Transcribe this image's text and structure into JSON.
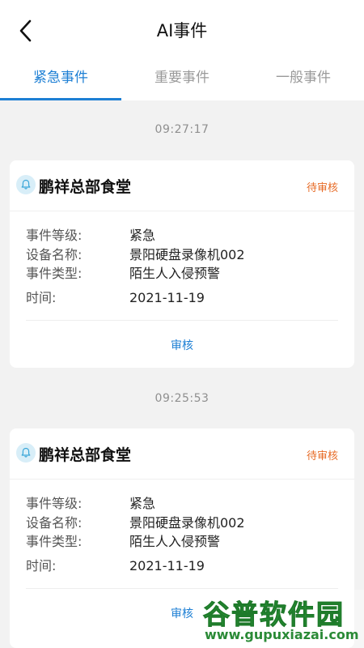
{
  "header": {
    "title": "AI事件"
  },
  "tabs": [
    {
      "label": "紧急事件",
      "active": true
    },
    {
      "label": "重要事件",
      "active": false
    },
    {
      "label": "一般事件",
      "active": false
    }
  ],
  "events": [
    {
      "time": "09:27:17",
      "name": "鹏祥总部食堂",
      "status": "待审核",
      "fields": [
        {
          "key": "事件等级:",
          "value": "紧急"
        },
        {
          "key": "设备名称:",
          "value": "景阳硬盘录像机002"
        },
        {
          "key": "事件类型:",
          "value": "陌生人入侵预警"
        },
        {
          "key": "时间:",
          "value": "2021-11-19"
        }
      ],
      "action": "审核"
    },
    {
      "time": "09:25:53",
      "name": "鹏祥总部食堂",
      "status": "待审核",
      "fields": [
        {
          "key": "事件等级:",
          "value": "紧急"
        },
        {
          "key": "设备名称:",
          "value": "景阳硬盘录像机002"
        },
        {
          "key": "事件类型:",
          "value": "陌生人入侵预警"
        },
        {
          "key": "时间:",
          "value": "2021-11-19"
        }
      ],
      "action": "审核"
    }
  ],
  "watermark": {
    "text": "谷普软件园",
    "url": "www.gupuxiazai.com"
  },
  "colors": {
    "accent": "#1d7fd4",
    "pending": "#e76b26",
    "background": "#f2f2f2"
  }
}
